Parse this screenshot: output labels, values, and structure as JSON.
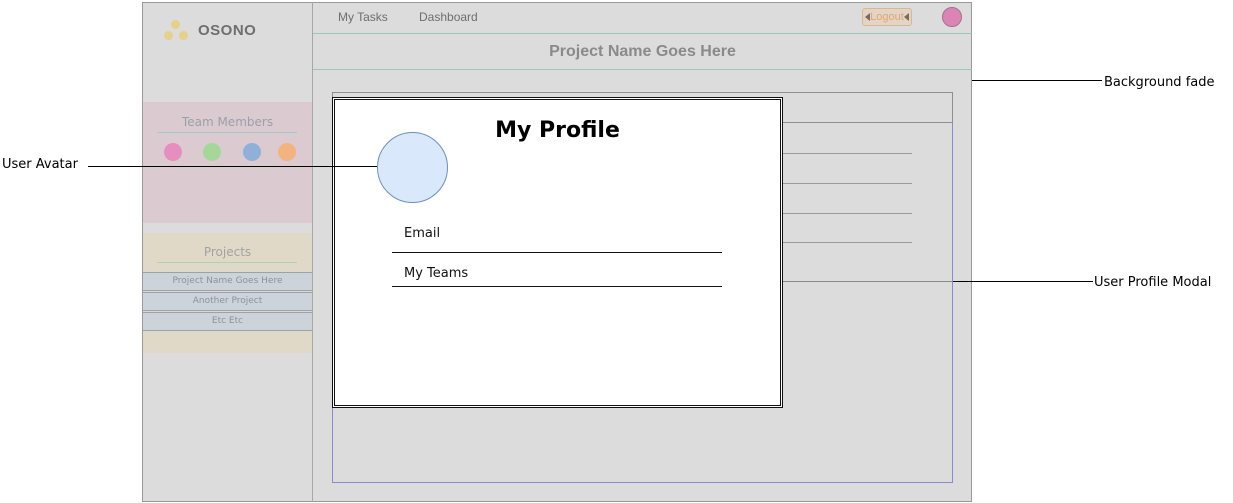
{
  "app": {
    "logo_text": "OSONO",
    "nav": {
      "my_tasks": "My Tasks",
      "dashboard": "Dashboard",
      "logout": "Logout"
    },
    "project_title": "Project Name Goes Here"
  },
  "sidebar": {
    "team_title": "Team Members",
    "team_members": [
      {
        "color": "#e68fbf"
      },
      {
        "color": "#a6d79a"
      },
      {
        "color": "#8fb0d8"
      },
      {
        "color": "#f2b37f"
      }
    ],
    "projects_title": "Projects",
    "projects": [
      {
        "label": "Project Name Goes Here"
      },
      {
        "label": "Another Project"
      },
      {
        "label": "Etc Etc"
      }
    ]
  },
  "modal": {
    "title": "My Profile",
    "fields": [
      {
        "label": "Email"
      },
      {
        "label": "My Teams"
      }
    ]
  },
  "annotations": {
    "background_fade": "Background fade",
    "user_avatar": "User Avatar",
    "user_profile_modal": "User Profile Modal"
  },
  "colors": {
    "fade_gray": "#dcdcdc",
    "avatar_fill": "#dae8fb",
    "avatar_stroke": "#6c8ebf",
    "logo_dots": "#e6d08a"
  }
}
